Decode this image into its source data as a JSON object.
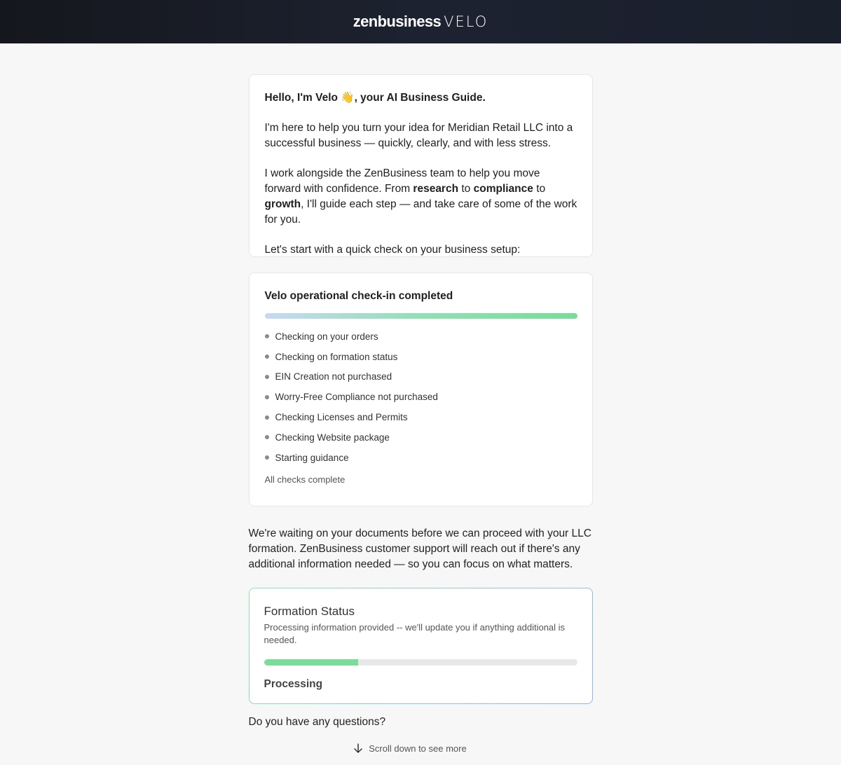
{
  "header": {
    "brand_main": "zenbusiness",
    "brand_sub": "VELO"
  },
  "intro": {
    "hello": "Hello, I'm Velo 👋, your AI Business Guide.",
    "para1": "I'm here to help you turn your idea for Meridian Retail LLC into a successful business — quickly, clearly, and with less stress.",
    "para2_start": "I work alongside the ZenBusiness team to help you move forward with confidence. From ",
    "para2_research": "research",
    "para2_to1": " to ",
    "para2_compliance": "compliance",
    "para2_to2": " to ",
    "para2_growth": "growth",
    "para2_end": ", I'll guide each step — and take care of some of the work for you.",
    "para3": "Let's start with a quick check on your business setup:"
  },
  "checkin": {
    "title": "Velo operational check-in completed",
    "progress": 1.0,
    "items": [
      "Checking on your orders",
      "Checking on formation status",
      "EIN Creation not purchased",
      "Worry-Free Compliance not purchased",
      "Checking Licenses and Permits",
      "Checking Website package",
      "Starting guidance"
    ],
    "footer": "All checks complete"
  },
  "waiting_message": "We're waiting on your documents before we can proceed with your LLC formation. ZenBusiness customer support will reach out if there's any additional information needed — so you can focus on what matters.",
  "formation": {
    "title": "Formation Status",
    "description": "Processing information provided -- we'll update you if anything additional is needed.",
    "progress_percent": 30,
    "status_label": "Processing"
  },
  "questions_prompt": "Do you have any questions?",
  "scroll_hint": {
    "label": "Scroll down to see more",
    "icon": "arrow-down-icon"
  },
  "colors": {
    "header_bg": "#1a1f2c",
    "progress_green": "#7ddc99",
    "gradient_start": "#c7d9f2",
    "gradient_end": "#76dd97",
    "status_border_blue": "#8fb4ea"
  }
}
